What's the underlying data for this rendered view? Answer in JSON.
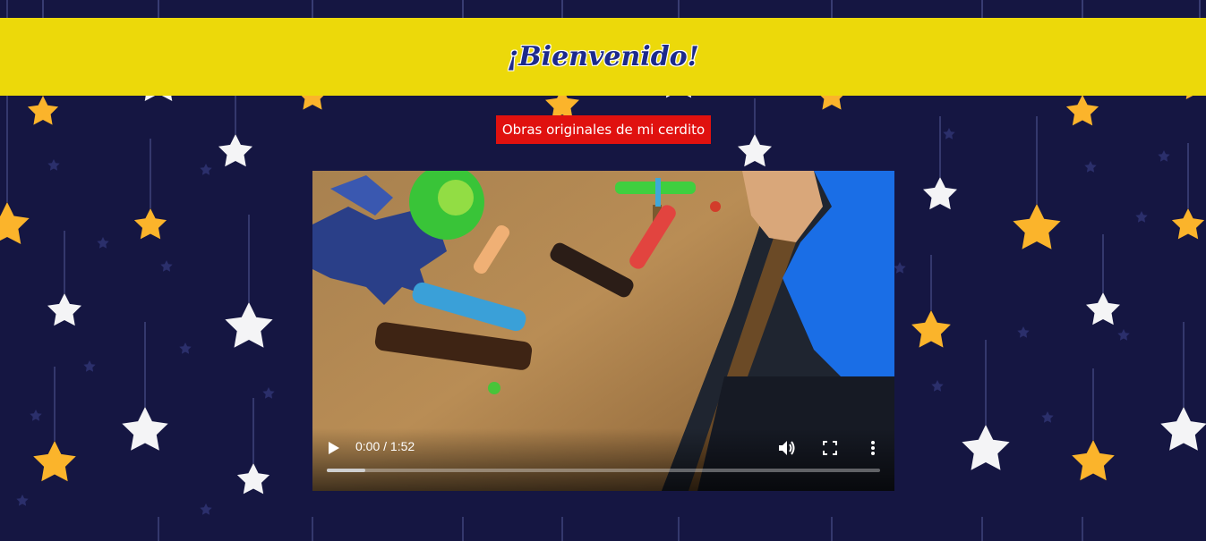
{
  "header": {
    "title": "¡Bienvenido!"
  },
  "subtitle_button": {
    "label": "Obras originales de mi cerdito"
  },
  "video": {
    "current_time": "0:00",
    "duration": "1:52",
    "time_display": "0:00 / 1:52",
    "buffered_fraction": 0.07,
    "icons": [
      "play-icon",
      "volume-icon",
      "fullscreen-icon",
      "more-options-icon"
    ]
  },
  "colors": {
    "background": "#151642",
    "banner": "#ecd90a",
    "title": "#1d2a8c",
    "button": "#e0110f",
    "star_gold": "#fbb42b",
    "star_white": "#f4f4f6"
  }
}
